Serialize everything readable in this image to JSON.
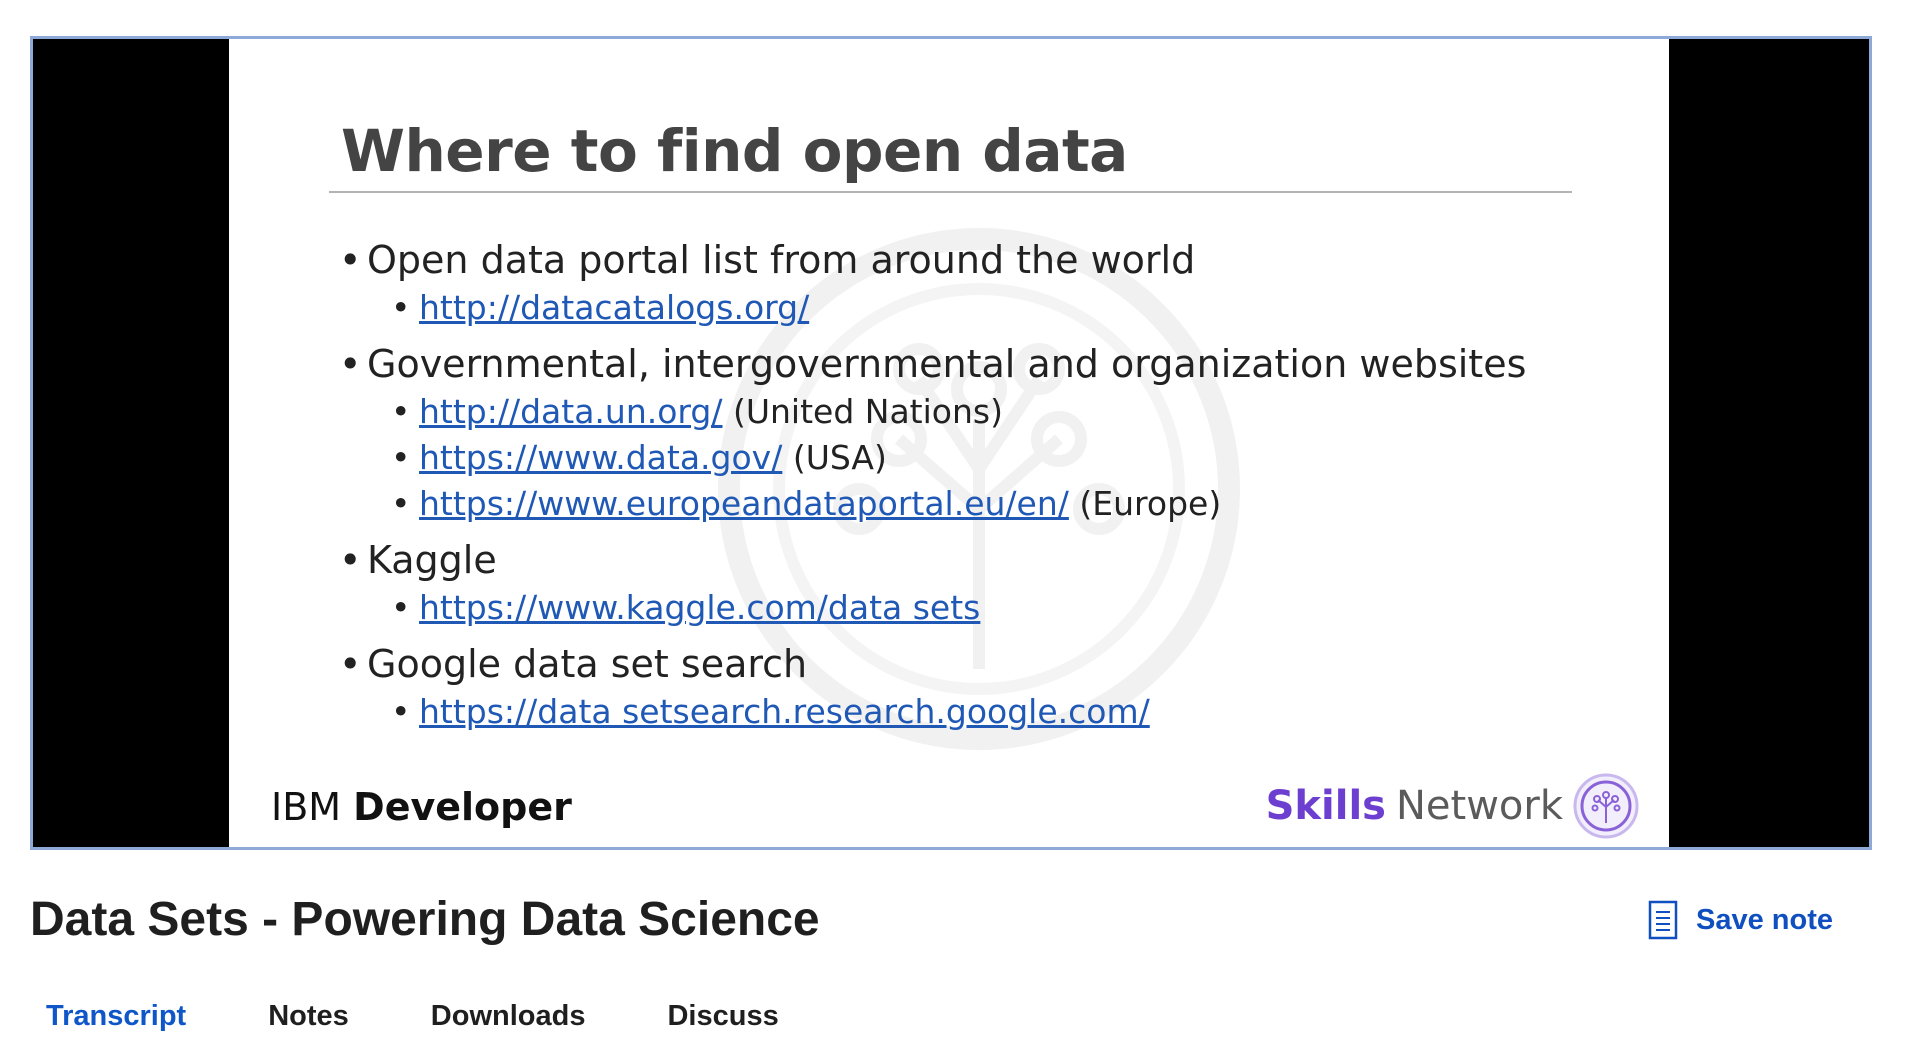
{
  "video": {
    "slide": {
      "title": "Where to find open data",
      "sections": [
        {
          "heading": "Open data portal list from around the world",
          "links": [
            {
              "url": "http://datacatalogs.org/",
              "note": ""
            }
          ]
        },
        {
          "heading": "Governmental, intergovernmental and organization websites",
          "links": [
            {
              "url": "http://data.un.org/",
              "note": "(United Nations)"
            },
            {
              "url": "https://www.data.gov/",
              "note": "(USA)"
            },
            {
              "url": "https://www.europeandataportal.eu/en/",
              "note": "(Europe)"
            }
          ]
        },
        {
          "heading": "Kaggle",
          "links": [
            {
              "url": "https://www.kaggle.com/data sets",
              "note": ""
            }
          ]
        },
        {
          "heading": "Google data set search",
          "links": [
            {
              "url": "https://data setsearch.research.google.com/",
              "note": ""
            }
          ]
        }
      ],
      "logo_left": {
        "regular": "IBM",
        "bold": "Developer"
      },
      "logo_right": {
        "bold": "Skills",
        "regular": "Network"
      }
    }
  },
  "page": {
    "title": "Data Sets - Powering Data Science",
    "save_note_label": "Save note",
    "save_note_icon": "note-icon"
  },
  "tabs": [
    {
      "label": "Transcript",
      "active": true
    },
    {
      "label": "Notes",
      "active": false
    },
    {
      "label": "Downloads",
      "active": false
    },
    {
      "label": "Discuss",
      "active": false
    }
  ],
  "colors": {
    "link": "#1f58b5",
    "accent": "#0f56c9",
    "skills_purple": "#6c3fd1",
    "frame_border": "#8ea8d8"
  }
}
